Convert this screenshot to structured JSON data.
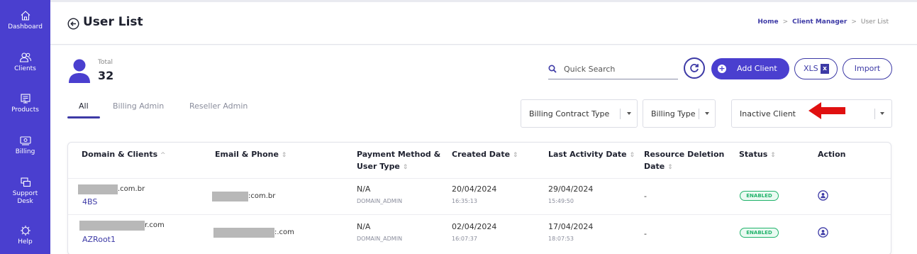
{
  "sidebar": {
    "items": [
      {
        "label": "Dashboard",
        "icon": "home-icon"
      },
      {
        "label": "Clients",
        "icon": "users-icon"
      },
      {
        "label": "Products",
        "icon": "products-icon"
      },
      {
        "label": "Billing",
        "icon": "billing-icon"
      },
      {
        "label": "Support Desk",
        "icon": "support-icon"
      },
      {
        "label": "Help",
        "icon": "help-icon"
      }
    ],
    "color": "#4a3fcf"
  },
  "header": {
    "title": "User List",
    "breadcrumb": {
      "home": "Home",
      "section": "Client Manager",
      "current": "User List"
    }
  },
  "summary": {
    "total_label": "Total",
    "total_value": "32"
  },
  "search": {
    "placeholder": "Quick Search"
  },
  "buttons": {
    "add_client": "Add Client",
    "xls": "XLS",
    "xls_glyph": "x",
    "import": "Import"
  },
  "tabs": [
    {
      "label": "All",
      "active": true
    },
    {
      "label": "Billing Admin",
      "active": false
    },
    {
      "label": "Reseller Admin",
      "active": false
    }
  ],
  "filters": {
    "billing_contract_type": "Billing Contract Type",
    "billing_type": "Billing Type",
    "client_status": "Inactive Client"
  },
  "table": {
    "headers": {
      "domain": "Domain & Clients",
      "domain_sort": "^",
      "email": "Email & Phone",
      "payment_line1": "Payment Method &",
      "payment_line2": "User Type",
      "created": "Created Date",
      "activity": "Last Activity Date",
      "deletion_line1": "Resource Deletion",
      "deletion_line2": "Date",
      "status": "Status",
      "action": "Action"
    },
    "rows": [
      {
        "domain_suffix": ".com.br",
        "client": "4BS",
        "email_suffix": ":com.br",
        "payment": "N/A",
        "user_type": "DOMAIN_ADMIN",
        "created_date": "20/04/2024",
        "created_time": "16:35:13",
        "activity_date": "29/04/2024",
        "activity_time": "15:49:50",
        "deletion": "-",
        "status": "ENABLED"
      },
      {
        "domain_suffix": "r.com",
        "client": "AZRoot1",
        "email_suffix": ":.com",
        "payment": "N/A",
        "user_type": "DOMAIN_ADMIN",
        "created_date": "02/04/2024",
        "created_time": "16:07:37",
        "activity_date": "17/04/2024",
        "activity_time": "18:07:53",
        "deletion": "-",
        "status": "ENABLED"
      }
    ]
  },
  "colors": {
    "accent": "#4a3fcf",
    "link": "#3d3aa6",
    "status_enabled": "#21b36b",
    "annotation_arrow": "#e01010"
  }
}
